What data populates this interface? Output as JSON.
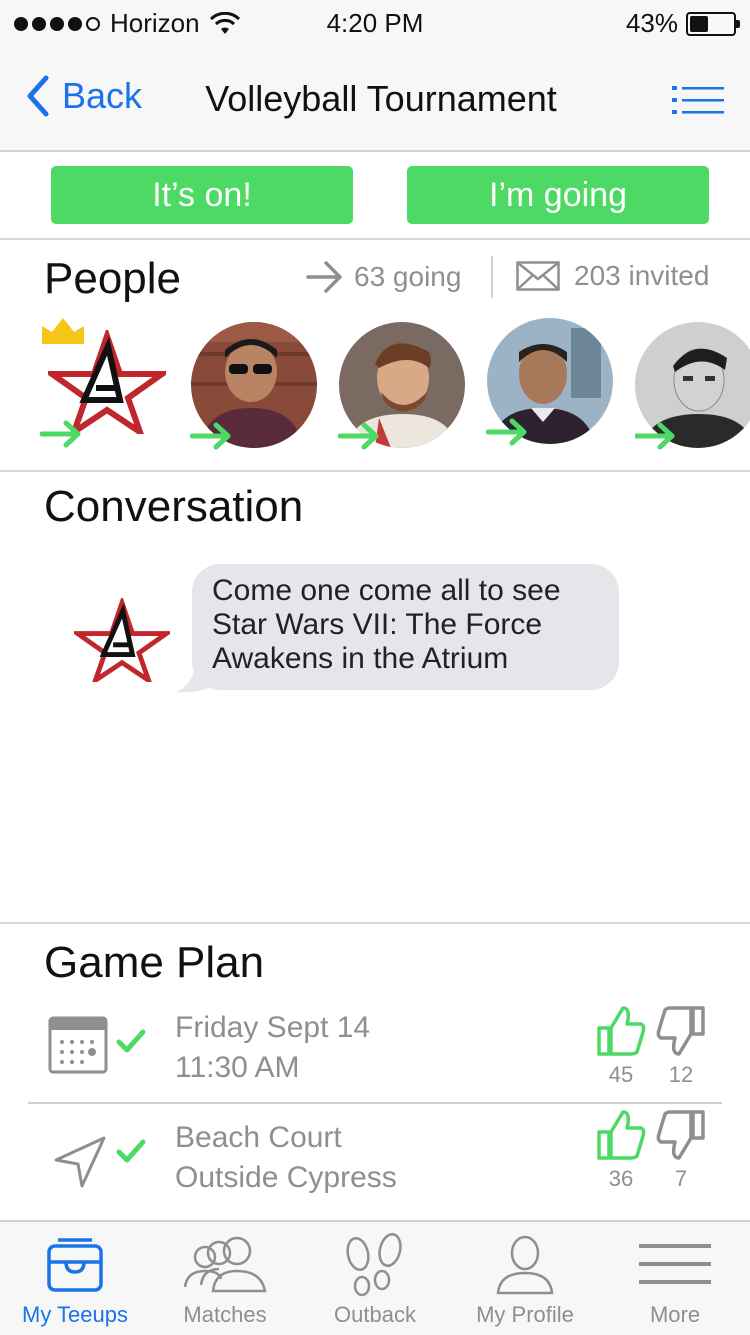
{
  "status_bar": {
    "carrier": "Horizon",
    "time": "4:20 PM",
    "battery_percent": "43%",
    "battery_level": 0.43,
    "signal_bars": 4
  },
  "nav": {
    "back_label": "Back",
    "title": "Volleyball Tournament"
  },
  "actions": {
    "its_on_label": "It’s on!",
    "im_going_label": "I’m going"
  },
  "people": {
    "title": "People",
    "going": "63 going",
    "invited": "203 invited",
    "avatars": [
      {
        "name": "organizer-logo",
        "is_host": true
      },
      {
        "name": "attendee-sunglasses"
      },
      {
        "name": "attendee-beard"
      },
      {
        "name": "attendee-smiling"
      },
      {
        "name": "attendee-bw"
      }
    ]
  },
  "conversation": {
    "title": "Conversation",
    "message": "Come one come all to see Star Wars VII: The Force Awakens in the Atrium"
  },
  "game_plan": {
    "title": "Game Plan",
    "items": [
      {
        "line1": "Friday Sept 14",
        "line2": "11:30 AM",
        "up": "45",
        "down": "12",
        "icon": "calendar-icon"
      },
      {
        "line1": "Beach Court",
        "line2": "Outside Cypress",
        "up": "36",
        "down": "7",
        "icon": "location-arrow-icon"
      }
    ]
  },
  "tabs": [
    {
      "label": "My Teeups",
      "active": true
    },
    {
      "label": "Matches"
    },
    {
      "label": "Outback"
    },
    {
      "label": "My Profile"
    },
    {
      "label": "More"
    }
  ],
  "colors": {
    "accent_blue": "#1a73e8",
    "green": "#4cd964",
    "gray_text": "#8e8e93",
    "crown_gold": "#f5c518",
    "logo_red": "#c0272d"
  }
}
